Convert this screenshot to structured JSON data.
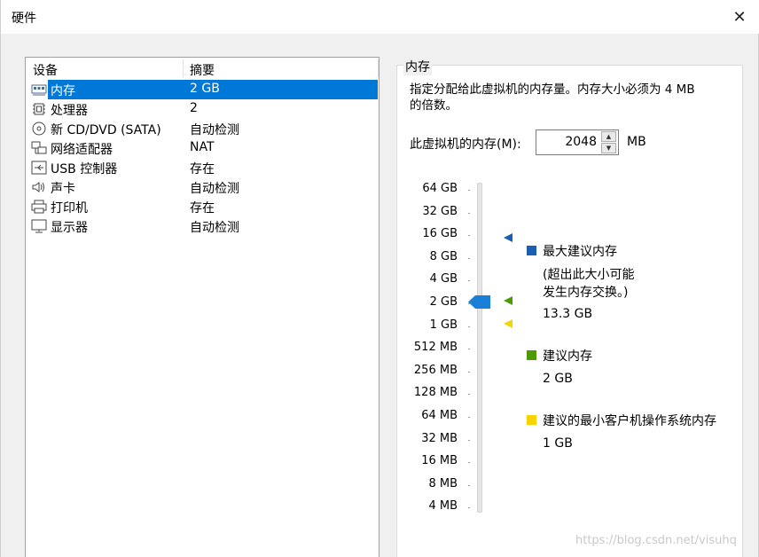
{
  "window": {
    "title": "硬件"
  },
  "device_list": {
    "headers": [
      "设备",
      "摘要"
    ],
    "rows": [
      {
        "icon": "memory-icon",
        "name": "内存",
        "summary": "2 GB",
        "selected": true
      },
      {
        "icon": "cpu-icon",
        "name": "处理器",
        "summary": "2"
      },
      {
        "icon": "cd-dvd-icon",
        "name": "新 CD/DVD (SATA)",
        "summary": "自动检测"
      },
      {
        "icon": "network-adapter-icon",
        "name": "网络适配器",
        "summary": "NAT"
      },
      {
        "icon": "usb-icon",
        "name": "USB 控制器",
        "summary": "存在"
      },
      {
        "icon": "speaker-icon",
        "name": "声卡",
        "summary": "自动检测"
      },
      {
        "icon": "printer-icon",
        "name": "打印机",
        "summary": "存在"
      },
      {
        "icon": "monitor-icon",
        "name": "显示器",
        "summary": "自动检测"
      }
    ]
  },
  "memory": {
    "group_title": "内存",
    "description_line1": "指定分配给此虚拟机的内存量。内存大小必须为 4 MB",
    "description_line2": "的倍数。",
    "label": "此虚拟机的内存(M):",
    "value": "2048",
    "unit": "MB",
    "slider_ticks": [
      "64 GB",
      "32 GB",
      "16 GB",
      "8 GB",
      "4 GB",
      "2 GB",
      "1 GB",
      "512 MB",
      "256 MB",
      "128 MB",
      "64 MB",
      "32 MB",
      "16 MB",
      "8 MB",
      "4 MB"
    ],
    "slider_selected": "2 GB",
    "legend": {
      "max": {
        "title": "最大建议内存",
        "note_line1": "(超出此大小可能",
        "note_line2": "发生内存交换。)",
        "value": "13.3 GB",
        "color": "#1a5fb4"
      },
      "recommended": {
        "title": "建议内存",
        "value": "2 GB",
        "color": "#4e9a06"
      },
      "min": {
        "title": "建议的最小客户机操作系统内存",
        "value": "1 GB",
        "color": "#f5d400"
      }
    }
  },
  "watermark": "https://blog.csdn.net/visuhq"
}
